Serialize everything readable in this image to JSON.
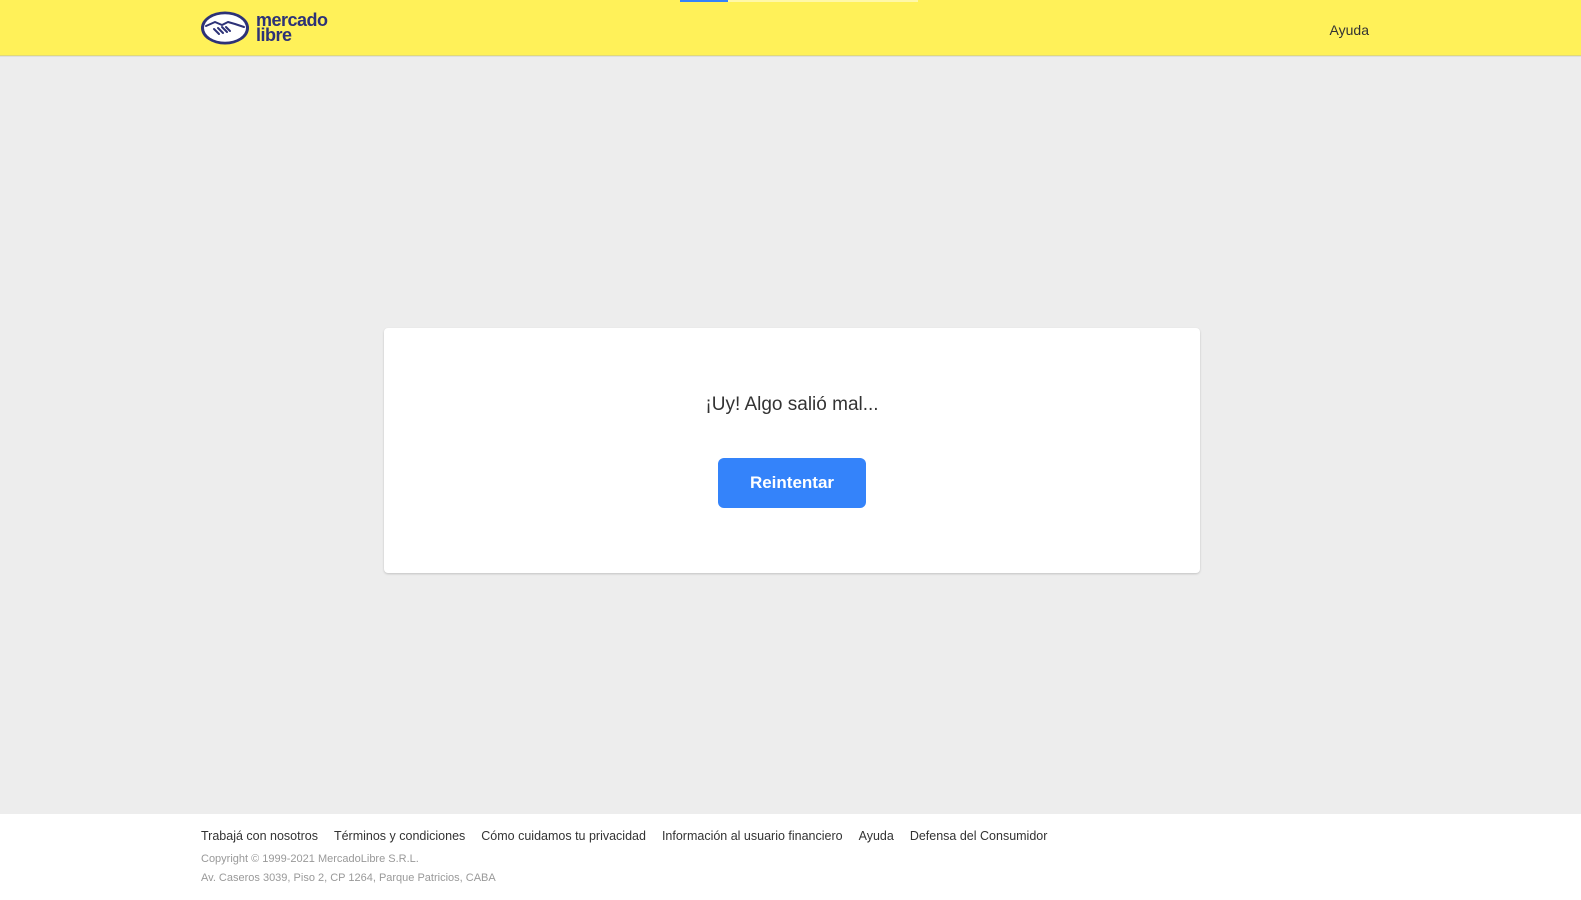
{
  "header": {
    "logo": {
      "icon": "handshake-icon",
      "line1": "mercado",
      "line2": "libre"
    },
    "help_label": "Ayuda"
  },
  "error_card": {
    "title": "¡Uy! Algo salió mal...",
    "retry_label": "Reintentar"
  },
  "footer": {
    "links": [
      "Trabajá con nosotros",
      "Términos y condiciones",
      "Cómo cuidamos tu privacidad",
      "Información al usuario financiero",
      "Ayuda",
      "Defensa del Consumidor"
    ],
    "copyright": "Copyright © 1999-2021 MercadoLibre S.R.L.",
    "address": "Av. Caseros 3039, Piso 2, CP 1264, Parque Patricios, CABA"
  },
  "colors": {
    "header_bg": "#fff159",
    "brand_navy": "#2d3277",
    "primary_blue": "#3483fa",
    "page_bg": "#ededed"
  }
}
